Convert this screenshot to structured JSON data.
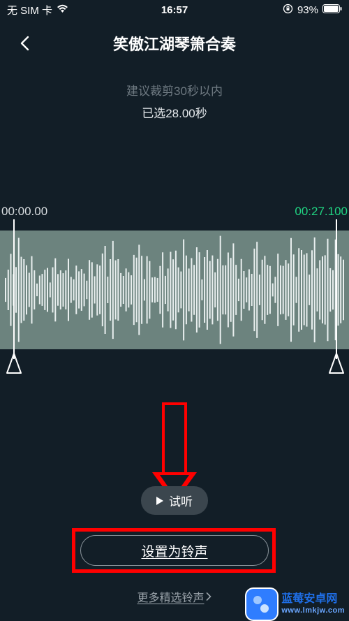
{
  "status_bar": {
    "carrier": "无 SIM 卡",
    "time": "16:57",
    "battery_pct": "93%"
  },
  "header": {
    "title": "笑傲江湖琴箫合奏"
  },
  "hints": {
    "trim_advice": "建议裁剪30秒以内",
    "selected": "已选28.00秒"
  },
  "trim": {
    "start_label": "00:00.00",
    "end_label": "00:27.100"
  },
  "actions": {
    "preview_label": "试听",
    "set_label": "设置为铃声",
    "more_label": "更多精选铃声"
  },
  "watermark": {
    "line1": "蓝莓安卓网",
    "line2": "www.lmkjw.com"
  },
  "annotation": {
    "arrow_color": "#ff0000"
  }
}
